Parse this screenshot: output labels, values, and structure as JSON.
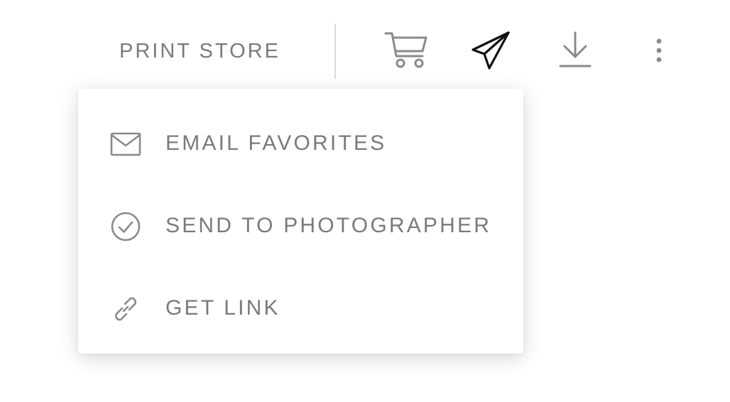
{
  "toolbar": {
    "print_store_label": "PRINT STORE",
    "icons": [
      "cart-icon",
      "paper-plane-icon",
      "download-icon",
      "more-vertical-icon"
    ]
  },
  "menu": {
    "items": [
      {
        "label": "EMAIL FAVORITES",
        "icon": "envelope-icon"
      },
      {
        "label": "SEND TO PHOTOGRAPHER",
        "icon": "check-circle-icon"
      },
      {
        "label": "GET LINK",
        "icon": "link-icon"
      }
    ]
  },
  "colors": {
    "text": "#7a7a7a",
    "icon_muted": "#8a8a8a",
    "icon_active": "#111111",
    "divider": "#d9d9d9",
    "background": "#ffffff"
  }
}
